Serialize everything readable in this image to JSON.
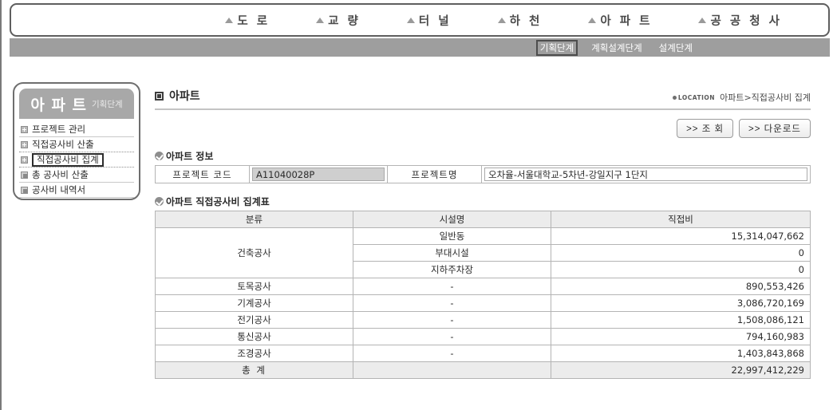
{
  "topnav": {
    "items": [
      {
        "label": "도 로",
        "icon": "triangle-icon"
      },
      {
        "label": "교 량",
        "icon": "triangle-icon"
      },
      {
        "label": "터 널",
        "icon": "triangle-icon"
      },
      {
        "label": "하 천",
        "icon": "triangle-icon"
      },
      {
        "label": "아 파 트",
        "icon": "triangle-icon"
      },
      {
        "label": "공 공 청 사",
        "icon": "triangle-icon"
      }
    ]
  },
  "stagebar": {
    "items": [
      {
        "label": "기획단계",
        "active": true
      },
      {
        "label": "계획설계단계",
        "active": false
      },
      {
        "label": "설계단계",
        "active": false
      }
    ]
  },
  "sidebar": {
    "title": "아 파 트",
    "subtitle": "기획단계",
    "items": [
      {
        "label": "프로젝트 관리",
        "icon": "plus-box-icon",
        "selected": false
      },
      {
        "label": "직접공사비 산출",
        "icon": "plus-box-icon",
        "selected": false
      },
      {
        "label": "직접공사비 집계",
        "icon": "plus-box-icon",
        "selected": true
      },
      {
        "label": "총 공사비 산출",
        "icon": "square-box-icon",
        "selected": false
      },
      {
        "label": "공사비 내역서",
        "icon": "square-box-icon",
        "selected": false
      }
    ]
  },
  "header": {
    "title": "아파트",
    "location_badge": "LOCATION",
    "location_path": "아파트>직접공사비 집계"
  },
  "toolbar": {
    "search_label": ">> 조 회",
    "download_label": ">> 다운로드"
  },
  "info_section": {
    "title": "아파트 정보",
    "code_label": "프로젝트 코드",
    "code_value": "A11040028P",
    "name_label": "프로젝트명",
    "name_value": "오차율-서울대학교-5차년-강일지구 1단지"
  },
  "table_section": {
    "title": "아파트 직접공사비 집계표",
    "columns": [
      "분류",
      "시설명",
      "직접비"
    ],
    "groups": [
      {
        "category": "건축공사",
        "rowspan": 3,
        "rows": [
          {
            "facility": "일반동",
            "amount": "15,314,047,662"
          },
          {
            "facility": "부대시설",
            "amount": "0"
          },
          {
            "facility": "지하주차장",
            "amount": "0"
          }
        ]
      }
    ],
    "rows": [
      {
        "category": "토목공사",
        "facility": "-",
        "amount": "890,553,426"
      },
      {
        "category": "기계공사",
        "facility": "-",
        "amount": "3,086,720,169"
      },
      {
        "category": "전기공사",
        "facility": "-",
        "amount": "1,508,086,121"
      },
      {
        "category": "통신공사",
        "facility": "-",
        "amount": "794,160,983"
      },
      {
        "category": "조경공사",
        "facility": "-",
        "amount": "1,403,843,868"
      }
    ],
    "total": {
      "category": "총 계",
      "facility": "",
      "amount": "22,997,412,229"
    }
  }
}
